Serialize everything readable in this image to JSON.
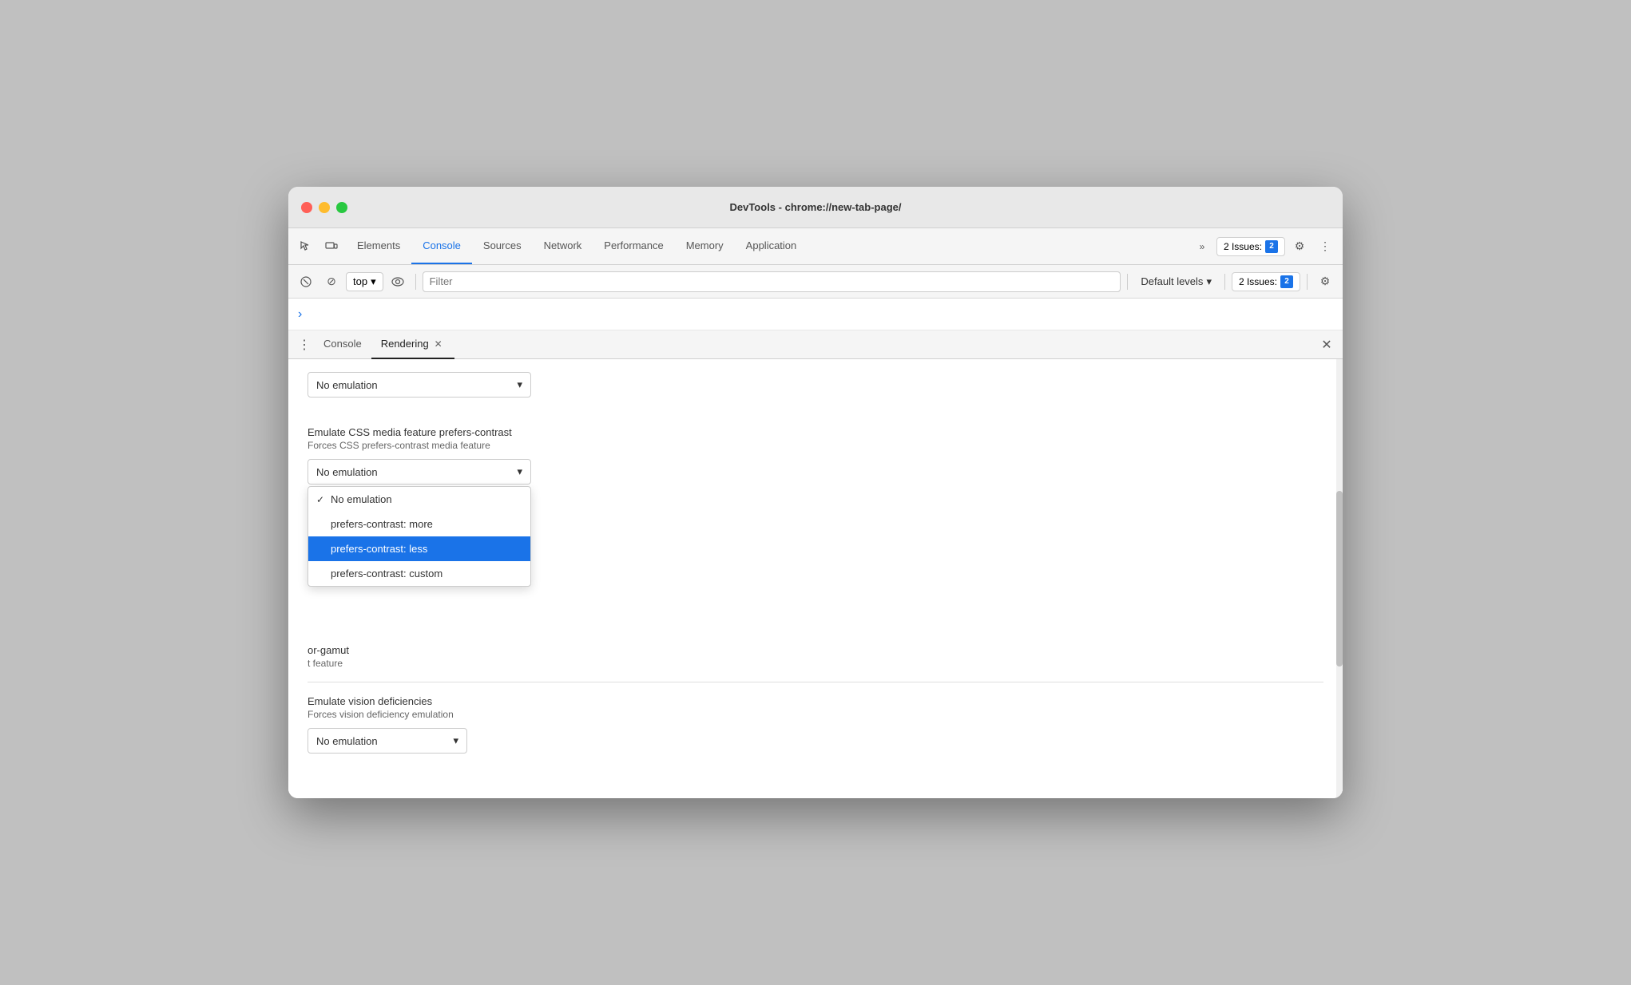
{
  "window": {
    "title": "DevTools - chrome://new-tab-page/"
  },
  "trafficLights": {
    "red": "red",
    "yellow": "yellow",
    "green": "green"
  },
  "tabs": [
    {
      "label": "Elements",
      "active": false
    },
    {
      "label": "Console",
      "active": true
    },
    {
      "label": "Sources",
      "active": false
    },
    {
      "label": "Network",
      "active": false
    },
    {
      "label": "Performance",
      "active": false
    },
    {
      "label": "Memory",
      "active": false
    },
    {
      "label": "Application",
      "active": false
    }
  ],
  "toolbar": {
    "topSelector": "top",
    "filterPlaceholder": "Filter",
    "defaultLevels": "Default levels",
    "issuesCount": "2 Issues:",
    "issuesBadgeNum": "2"
  },
  "panelTabs": [
    {
      "label": "Console",
      "active": false,
      "closeable": false
    },
    {
      "label": "Rendering",
      "active": true,
      "closeable": true
    }
  ],
  "rendering": {
    "contrastSection": {
      "label": "Emulate CSS media feature prefers-contrast",
      "desc": "Forces CSS prefers-contrast media feature",
      "selectedValue": "No emulation",
      "options": [
        {
          "label": "No emulation",
          "checked": true,
          "selected": false
        },
        {
          "label": "prefers-contrast: more",
          "checked": false,
          "selected": false
        },
        {
          "label": "prefers-contrast: less",
          "checked": false,
          "selected": true
        },
        {
          "label": "prefers-contrast: custom",
          "checked": false,
          "selected": false
        }
      ]
    },
    "gamutSection": {
      "label": "Emulate CSS media feature color-gamut",
      "partialLabel": "or-gamut",
      "partialDesc": "t feature"
    },
    "visionSection": {
      "label": "Emulate vision deficiencies",
      "desc": "Forces vision deficiency emulation",
      "selectedValue": "No emulation"
    },
    "topDropdown": {
      "selectedValue": "No emulation"
    }
  }
}
